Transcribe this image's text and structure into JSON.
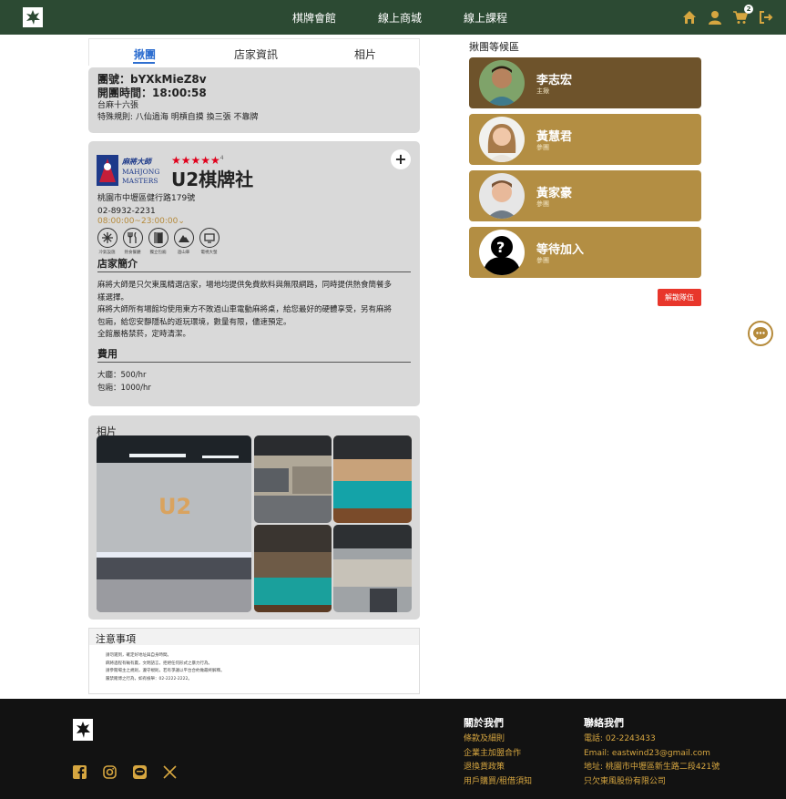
{
  "nav": {
    "links": [
      "棋牌會館",
      "線上商城",
      "線上課程"
    ],
    "cart_count": "2",
    "icons": [
      "home-icon",
      "user-icon",
      "cart-icon",
      "logout-icon"
    ]
  },
  "tabs": [
    "揪團",
    "店家資訊",
    "相片"
  ],
  "room": {
    "id_line": "團號：bYXkMieZ8v",
    "time_line": "開團時間：18:00:58",
    "game": "台麻十六張",
    "rules": "特殊規則: 八仙過海 明槓自摸 換三張 不靠牌"
  },
  "store": {
    "logo_text": "麻將大師",
    "logo_sub1": "MAHJONG",
    "logo_sub2": "MASTERS",
    "stars": "★★★★★",
    "rating": "4",
    "name": "U2棋牌社",
    "address": "桃園市中壢區健行路179號",
    "phone": "02-8932-2231",
    "hours": "08:00:00~23:00:00⌄",
    "amenities": [
      "冷氣設施",
      "熱食餐廳",
      "獨立包廂",
      "過山車",
      "電視大螢"
    ],
    "intro_title": "店家簡介",
    "intro": [
      "麻將大師是只欠東風精選店家，場地均提供免費飲料與無限網路，同時提供熱食簡餐多",
      "樣選擇。",
      "麻將大師所有場館均使用東方不敗過山車電動麻將桌，給您最好的硬體享受，另有麻將",
      "包廂，給您安靜隱私的遊玩環境，數量有限，儘速預定。",
      "全館嚴格禁菸，定時清潔。"
    ],
    "fee_title": "費用",
    "fees": [
      "大廳：500/hr",
      "包廂：1000/hr"
    ]
  },
  "photos": {
    "title": "相片"
  },
  "notice": {
    "title": "注意事項",
    "lines": [
      "請勿遲到，確定好地址與自身時間。",
      "麻將過程有輸有贏，文明語言，拒絕任何形式之暴力行為。",
      "請參閱場主之規則，遵守規則，若有爭議以平台合約做最終解釋。",
      "嚴禁賭博之行為，如有檢舉：02-2222-2222。"
    ]
  },
  "waiting": {
    "title": "揪團等候區",
    "players": [
      {
        "name": "李志宏",
        "role": "主揪",
        "color": "#6e532b"
      },
      {
        "name": "黃慧君",
        "role": "參團",
        "color": "#b38e43"
      },
      {
        "name": "黃家豪",
        "role": "參團",
        "color": "#b38e43"
      },
      {
        "name": "等待加入",
        "role": "參團",
        "color": "#b38e43"
      }
    ],
    "dissolve_label": "解散隊伍"
  },
  "footer": {
    "about_title": "關於我們",
    "about_links": [
      "條款及細則",
      "企業主加盟合作",
      "退換貨政策",
      "用戶購買/租借須知"
    ],
    "contact_title": "聯絡我們",
    "contact_lines": [
      "電話: 02-2243433",
      "Email: eastwind23@gmail.com",
      "地址: 桃園市中壢區新生路二段421號",
      "只欠東風股份有限公司"
    ],
    "social": [
      "facebook-icon",
      "instagram-icon",
      "line-icon",
      "x-icon"
    ]
  }
}
